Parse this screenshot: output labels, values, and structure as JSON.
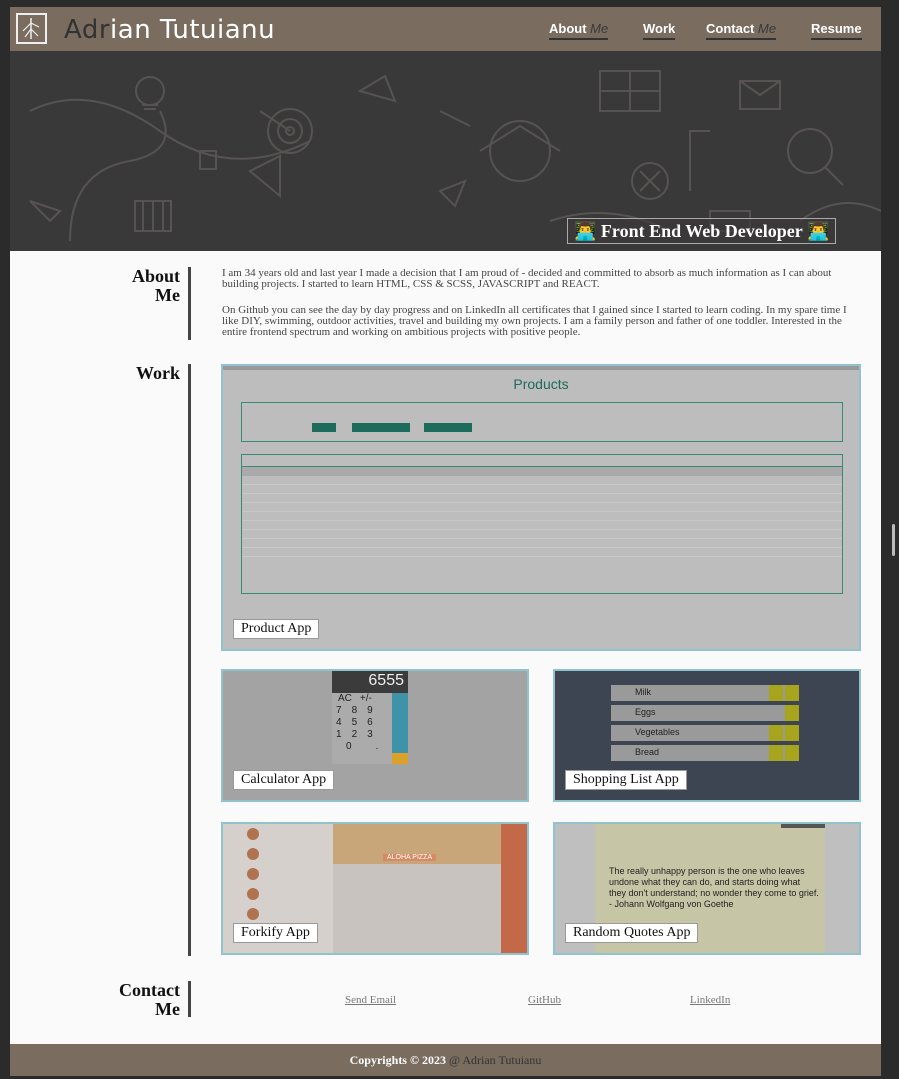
{
  "navbar": {
    "brand_dim": "Adr",
    "brand_mid": "ian Tutu",
    "brand_end": "ianu",
    "links": [
      {
        "main": "About",
        "sub": "Me"
      },
      {
        "main": "Work",
        "sub": ""
      },
      {
        "main": "Contact",
        "sub": "Me"
      },
      {
        "main": "Resume",
        "sub": ""
      }
    ]
  },
  "hero": {
    "badge": "Front End Web Developer"
  },
  "about": {
    "title_line1": "About",
    "title_line2": "Me",
    "p1": "I am 34 years old and last year I made a decision that I am proud of - decided and committed to absorb as much information as I can about building projects. I started to learn HTML, CSS & SCSS, JAVASCRIPT and REACT.",
    "p2": "On Github you can see the day by day progress and on LinkedIn all certificates that I gained since I started to learn coding. In my spare time I like DIY, swimming, outdoor activities, travel and building my own projects. I am a family person and father of one toddler. Interested in the entire frontend spectrum and working on ambitious projects with positive people."
  },
  "work": {
    "title": "Work",
    "projects": [
      {
        "label": "Product App"
      },
      {
        "label": "Calculator App"
      },
      {
        "label": "Shopping List App"
      },
      {
        "label": "Forkify App"
      },
      {
        "label": "Random Quotes App"
      }
    ],
    "product_preview_title": "Products",
    "calc_display": "6555",
    "calc_keys": [
      "AC",
      "+/-",
      "7",
      "8",
      "9",
      "4",
      "5",
      "6",
      "1",
      "2",
      "3",
      "0",
      "."
    ],
    "shopping_items": [
      "Milk",
      "Eggs",
      "Vegetables",
      "Bread"
    ],
    "quote_text": "The really unhappy person is the one who leaves undone what they can do, and starts doing what they don't understand; no wonder they come to grief. - Johann Wolfgang von Goethe",
    "pizza_banner": "ALOHA PIZZA"
  },
  "contact": {
    "title_line1": "Contact",
    "title_line2": "Me",
    "links": [
      {
        "label": "Send Email"
      },
      {
        "label": "GitHub"
      },
      {
        "label": "LinkedIn"
      }
    ]
  },
  "footer": {
    "text": "Copyrights © 2023",
    "author": "@ Adrian Tutuianu"
  },
  "colors": {
    "navbar": "#7a6d60",
    "hero_bg": "#3a3939",
    "card_border": "#8fc4cc",
    "page_bg": "#fafafa"
  }
}
